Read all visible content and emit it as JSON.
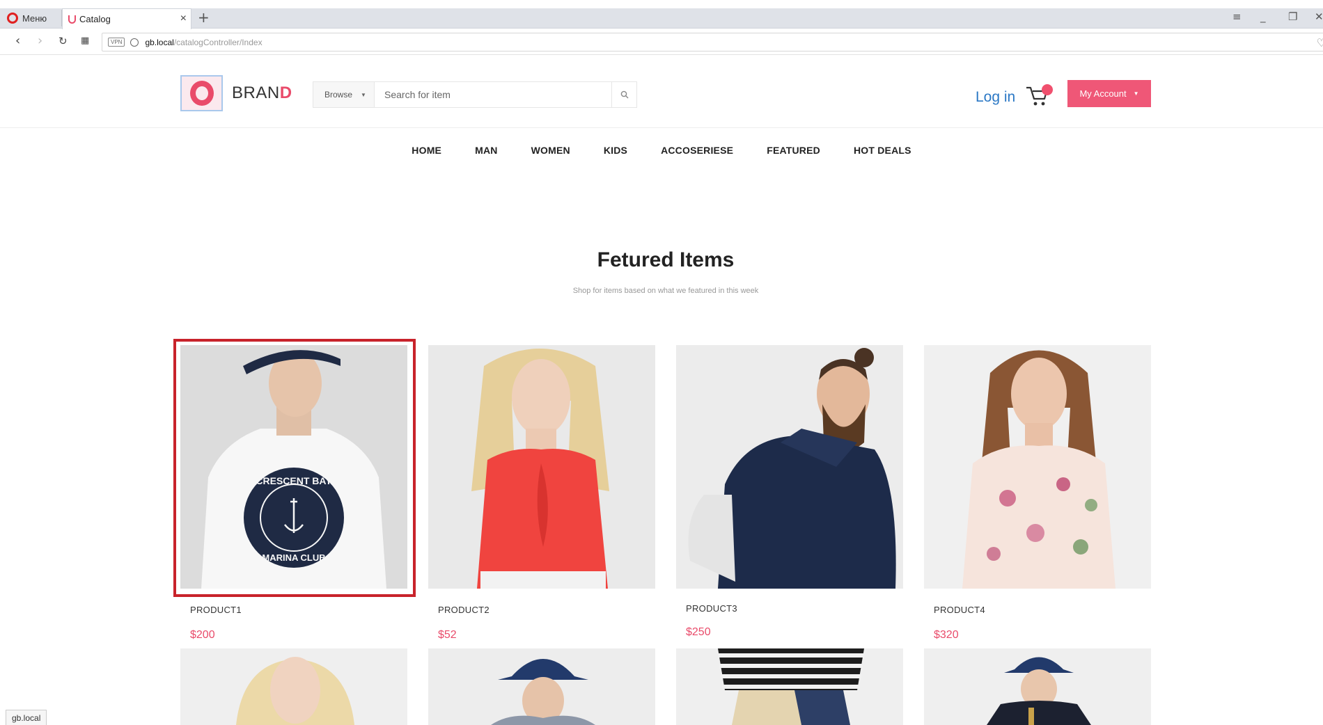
{
  "browser": {
    "menu_label": "Меню",
    "tab_title": "Catalog",
    "tab_close": "×",
    "new_tab": "+",
    "vpn_badge": "VPN",
    "url_host": "gb.local",
    "url_path": "/catalogController/Index",
    "status_url": "gb.local"
  },
  "header": {
    "brand_prefix": "BRAN",
    "brand_suffix": "D",
    "browse_label": "Browse",
    "search_placeholder": "Search for item",
    "login_label": "Log in",
    "account_label": "My Account"
  },
  "menu": [
    "HOME",
    "MAN",
    "WOMEN",
    "KIDS",
    "ACCOSERIESE",
    "FEATURED",
    "HOT DEALS"
  ],
  "featured": {
    "title": "Fetured Items",
    "subtitle": "Shop for items based on what we featured in this week"
  },
  "products": [
    {
      "name": "PRODUCT1",
      "price": "$200"
    },
    {
      "name": "PRODUCT2",
      "price": "$52"
    },
    {
      "name": "PRODUCT3",
      "price": "$250"
    },
    {
      "name": "PRODUCT4",
      "price": "$320"
    }
  ],
  "tshirt_print": {
    "top": "CRESCENT BAY",
    "bottom": "MARINA CLUB"
  },
  "colors": {
    "accent": "#e94b6a",
    "link": "#2b78c5",
    "highlight": "#c8232b"
  }
}
